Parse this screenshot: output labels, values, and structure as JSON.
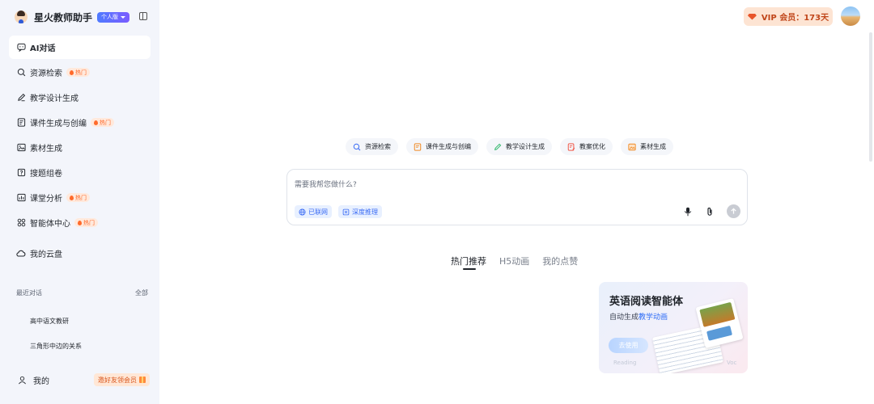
{
  "app": {
    "name": "星火教师助手",
    "tier_label": "个人版"
  },
  "nav": {
    "items": [
      {
        "label": "AI对话",
        "icon": "chat-bubble-icon",
        "hot": ""
      },
      {
        "label": "资源检索",
        "icon": "search-icon",
        "hot": "热门"
      },
      {
        "label": "教学设计生成",
        "icon": "pen-icon",
        "hot": ""
      },
      {
        "label": "课件生成与创编",
        "icon": "document-icon",
        "hot": "热门"
      },
      {
        "label": "素材生成",
        "icon": "image-icon",
        "hot": ""
      },
      {
        "label": "搜题组卷",
        "icon": "quiz-icon",
        "hot": ""
      },
      {
        "label": "课堂分析",
        "icon": "analytics-icon",
        "hot": "热门"
      },
      {
        "label": "智能体中心",
        "icon": "agents-icon",
        "hot": "热门"
      },
      {
        "label": "我的云盘",
        "icon": "cloud-icon",
        "hot": ""
      }
    ]
  },
  "recent": {
    "heading": "最近对话",
    "all_label": "全部",
    "items": [
      "高中语文教研",
      "三角形中边的关系"
    ]
  },
  "user": {
    "label": "我的",
    "invite_label": "邀好友领会员"
  },
  "vip": {
    "label": "VIP 会员：173天"
  },
  "chips": [
    {
      "label": "资源检索",
      "icon": "search-icon",
      "color": "#3b6cf5"
    },
    {
      "label": "课件生成与创编",
      "icon": "document-icon",
      "color": "#f08a24"
    },
    {
      "label": "教学设计生成",
      "icon": "pen-icon",
      "color": "#2fb86b"
    },
    {
      "label": "教案优化",
      "icon": "edit-doc-icon",
      "color": "#f05a4a"
    },
    {
      "label": "素材生成",
      "icon": "image-icon",
      "color": "#f08a24"
    }
  ],
  "chat": {
    "placeholder": "需要我帮您做什么?",
    "web_label": "已联网",
    "reason_label": "深度推理"
  },
  "tabs": [
    "热门推荐",
    "H5动画",
    "我的点赞"
  ],
  "card": {
    "title": "英语阅读智能体",
    "subtitle_prefix": "自动生成",
    "subtitle_highlight": "教学动画",
    "button": "去使用",
    "faint_left": "Reading",
    "faint_right": "Voc"
  }
}
